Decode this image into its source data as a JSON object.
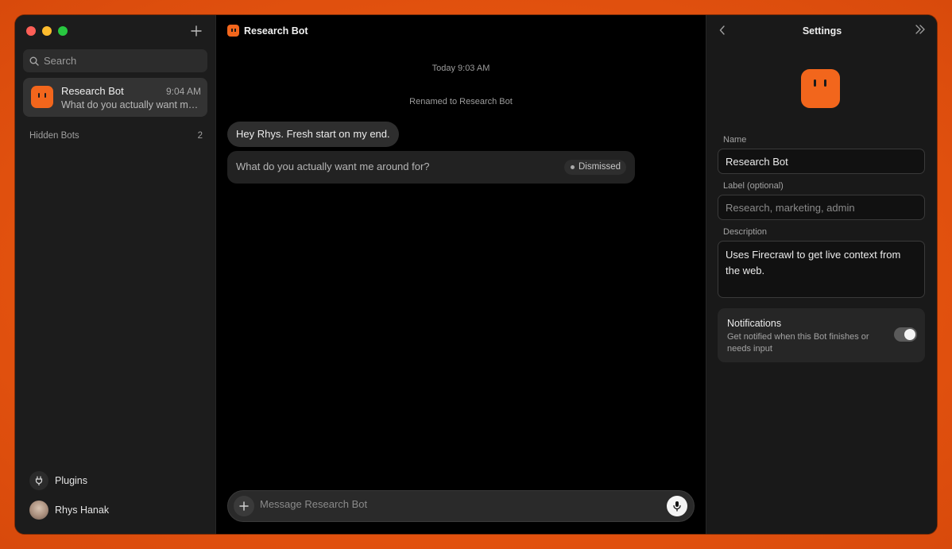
{
  "sidebar": {
    "search_placeholder": "Search",
    "bots": [
      {
        "name": "Research Bot",
        "time": "9:04 AM",
        "preview": "What do you actually want me around for?"
      }
    ],
    "hidden_bots": {
      "label": "Hidden Bots",
      "count": "2"
    },
    "plugins_label": "Plugins",
    "user_name": "Rhys Hanak"
  },
  "chat": {
    "title": "Research Bot",
    "date_stamp": "Today 9:03 AM",
    "rename_note": "Renamed to Research Bot",
    "messages": [
      {
        "text": "Hey Rhys. Fresh start on my end."
      },
      {
        "text": "What do you actually want me around for?",
        "status": "Dismissed"
      }
    ],
    "composer_placeholder": "Message Research Bot"
  },
  "settings": {
    "title": "Settings",
    "name_label": "Name",
    "name_value": "Research Bot",
    "label_label": "Label (optional)",
    "label_placeholder": "Research, marketing, admin",
    "description_label": "Description",
    "description_value": "Uses Firecrawl to get live context from the web.",
    "notifications": {
      "title": "Notifications",
      "description": "Get notified when this Bot finishes or needs input",
      "enabled": true
    }
  },
  "colors": {
    "accent": "#f2661c",
    "background": "#000000",
    "sidebar": "#1c1c1c"
  }
}
